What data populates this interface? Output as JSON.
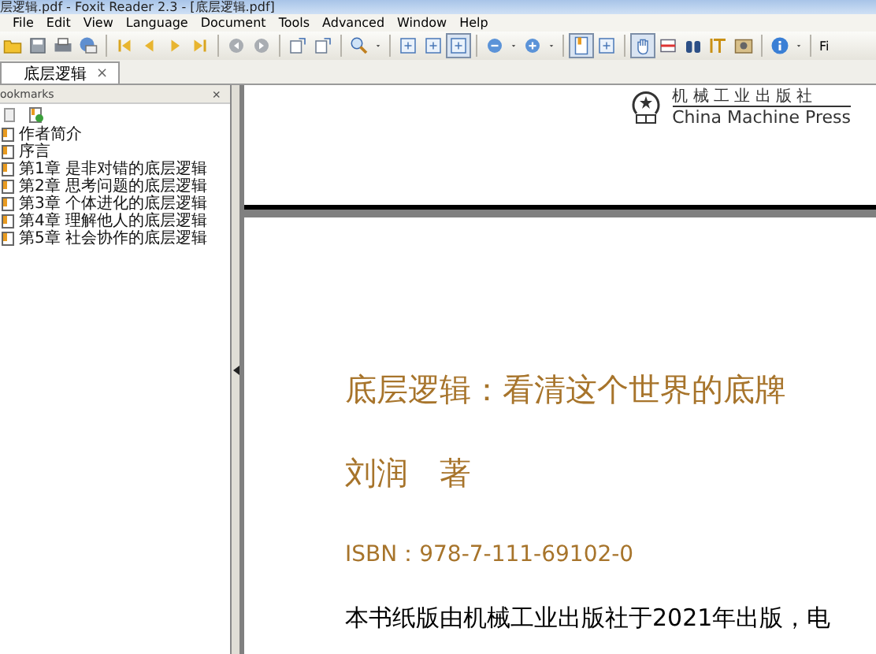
{
  "window": {
    "title": "层逻辑.pdf - Foxit Reader 2.3 - [底层逻辑.pdf]"
  },
  "menu": [
    "File",
    "Edit",
    "View",
    "Language",
    "Document",
    "Tools",
    "Advanced",
    "Window",
    "Help"
  ],
  "toolbar": [
    {
      "kind": "open"
    },
    {
      "kind": "save"
    },
    {
      "kind": "print"
    },
    {
      "kind": "email"
    },
    {
      "kind": "separator"
    },
    {
      "kind": "first"
    },
    {
      "kind": "prev"
    },
    {
      "kind": "next"
    },
    {
      "kind": "last"
    },
    {
      "kind": "separator"
    },
    {
      "kind": "back"
    },
    {
      "kind": "forward"
    },
    {
      "kind": "separator"
    },
    {
      "kind": "rotate"
    },
    {
      "kind": "rotate"
    },
    {
      "kind": "separator"
    },
    {
      "kind": "zoom"
    },
    {
      "kind": "caret"
    },
    {
      "kind": "separator"
    },
    {
      "kind": "fit",
      "selected": false
    },
    {
      "kind": "fit",
      "selected": false
    },
    {
      "kind": "fit",
      "selected": true
    },
    {
      "kind": "separator"
    },
    {
      "kind": "zoomout"
    },
    {
      "kind": "caret"
    },
    {
      "kind": "zoomin"
    },
    {
      "kind": "caret"
    },
    {
      "kind": "separator"
    },
    {
      "kind": "page",
      "selected": true
    },
    {
      "kind": "fit",
      "selected": false
    },
    {
      "kind": "separator"
    },
    {
      "kind": "hand",
      "selected": true
    },
    {
      "kind": "select",
      "selected": false
    },
    {
      "kind": "find"
    },
    {
      "kind": "text",
      "selected": false
    },
    {
      "kind": "snapshot",
      "selected": false
    },
    {
      "kind": "separator"
    },
    {
      "kind": "info"
    },
    {
      "kind": "caret"
    },
    {
      "kind": "separator"
    }
  ],
  "toolbar_overflow": "Fi",
  "tabs": [
    {
      "label": "底层逻辑",
      "selected": true,
      "close": "×"
    }
  ],
  "sidebar": {
    "title": "ookmarks",
    "close": "×",
    "items": [
      {
        "label": "作者简介"
      },
      {
        "label": "序言"
      },
      {
        "label": "第1章 是非对错的底层逻辑"
      },
      {
        "label": "第2章 思考问题的底层逻辑"
      },
      {
        "label": "第3章 个体进化的底层逻辑"
      },
      {
        "label": "第4章 理解他人的底层逻辑"
      },
      {
        "label": "第5章 社会协作的底层逻辑"
      }
    ]
  },
  "document": {
    "publisher_cn": "机 械 工 业 出 版 社",
    "publisher_en": "China Machine Press",
    "book_title": "底层逻辑：看清这个世界的底牌",
    "author": "刘润　著",
    "isbn": "ISBN：978-7-111-69102-0",
    "body": "本书纸版由机械工业出版社于2021年出版，电"
  }
}
